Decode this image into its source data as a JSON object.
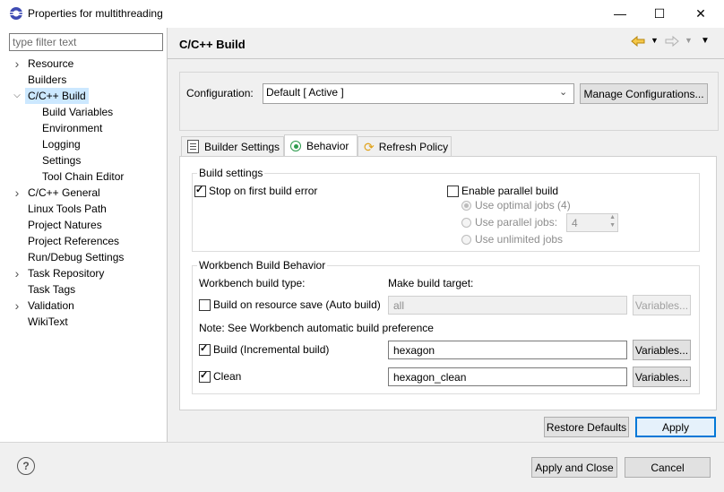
{
  "window": {
    "title": "Properties for multithreading",
    "minimize_glyph": "—",
    "maximize_glyph": "☐",
    "close_glyph": "✕"
  },
  "sidebar": {
    "filter_placeholder": "type filter text",
    "items": [
      {
        "label": "Resource",
        "expandable": true,
        "expanded": false,
        "level": 0
      },
      {
        "label": "Builders",
        "expandable": false,
        "level": 0
      },
      {
        "label": "C/C++ Build",
        "expandable": true,
        "expanded": true,
        "level": 0,
        "selected": true
      },
      {
        "label": "Build Variables",
        "level": 1
      },
      {
        "label": "Environment",
        "level": 1
      },
      {
        "label": "Logging",
        "level": 1
      },
      {
        "label": "Settings",
        "level": 1
      },
      {
        "label": "Tool Chain Editor",
        "level": 1
      },
      {
        "label": "C/C++ General",
        "expandable": true,
        "expanded": false,
        "level": 0
      },
      {
        "label": "Linux Tools Path",
        "level": 0
      },
      {
        "label": "Project Natures",
        "level": 0
      },
      {
        "label": "Project References",
        "level": 0
      },
      {
        "label": "Run/Debug Settings",
        "level": 0
      },
      {
        "label": "Task Repository",
        "expandable": true,
        "expanded": false,
        "level": 0
      },
      {
        "label": "Task Tags",
        "level": 0
      },
      {
        "label": "Validation",
        "expandable": true,
        "expanded": false,
        "level": 0
      },
      {
        "label": "WikiText",
        "level": 0
      }
    ]
  },
  "page": {
    "title": "C/C++ Build",
    "configuration_label": "Configuration:",
    "configuration_value": "Default  [ Active ]",
    "manage_button": "Manage Configurations..."
  },
  "tabs": [
    {
      "label": "Builder Settings",
      "icon": "builder-settings-icon",
      "active": false
    },
    {
      "label": "Behavior",
      "icon": "behavior-icon",
      "active": true
    },
    {
      "label": "Refresh Policy",
      "icon": "refresh-policy-icon",
      "active": false
    }
  ],
  "build_settings": {
    "legend": "Build settings",
    "stop_on_error": {
      "label": "Stop on first build error",
      "checked": true
    },
    "parallel_build": {
      "label": "Enable parallel build",
      "checked": false
    },
    "optimal_jobs": {
      "label": "Use optimal jobs (4)",
      "selected": true
    },
    "parallel_jobs": {
      "label": "Use parallel jobs:",
      "selected": false,
      "value": "4"
    },
    "unlimited_jobs": {
      "label": "Use unlimited jobs",
      "selected": false
    }
  },
  "workbench": {
    "legend": "Workbench Build Behavior",
    "build_type_header": "Workbench build type:",
    "make_target_header": "Make build target:",
    "auto_build": {
      "label": "Build on resource save (Auto build)",
      "checked": false,
      "target": "all",
      "variables": "Variables..."
    },
    "note": "Note: See Workbench automatic build preference",
    "incremental": {
      "label": "Build (Incremental build)",
      "checked": true,
      "target": "hexagon",
      "variables": "Variables..."
    },
    "clean": {
      "label": "Clean",
      "checked": true,
      "target": "hexagon_clean",
      "variables": "Variables..."
    }
  },
  "footer": {
    "restore_defaults": "Restore Defaults",
    "apply": "Apply",
    "apply_and_close": "Apply and Close",
    "cancel": "Cancel",
    "help_glyph": "?"
  },
  "colors": {
    "selection": "#cce8ff",
    "nav_arrow_active": "#e8b22c",
    "accent": "#0078d7"
  }
}
